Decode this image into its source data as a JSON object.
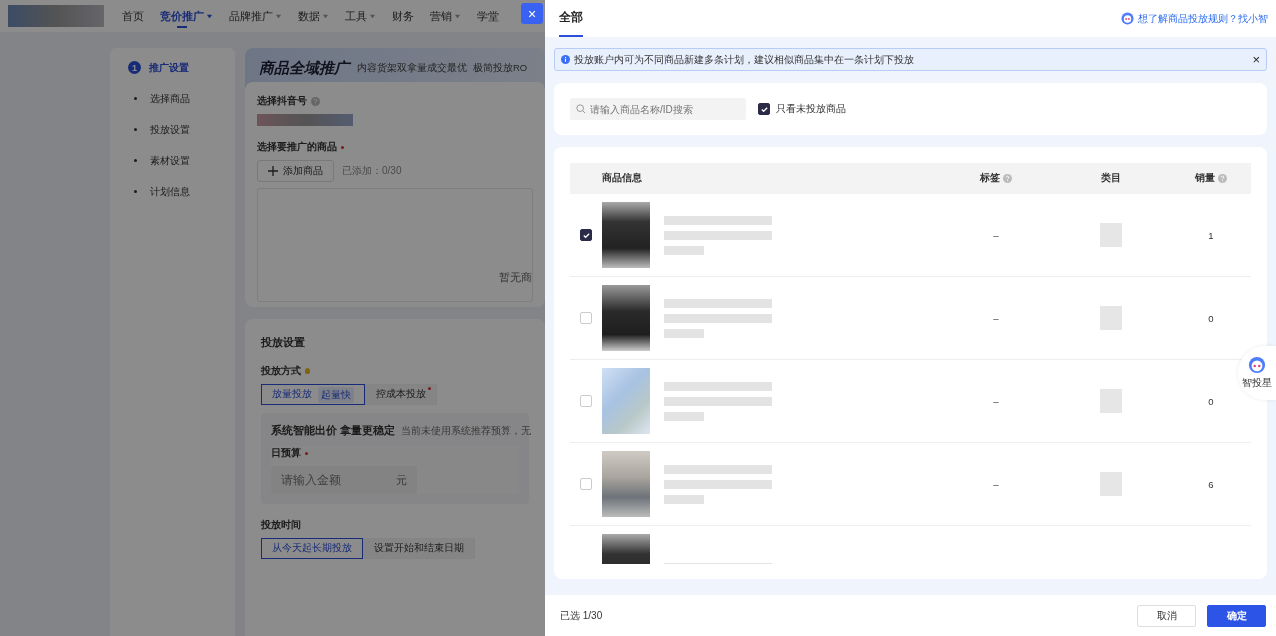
{
  "nav": {
    "items": [
      {
        "label": "首页",
        "selected": false,
        "dropdown": false
      },
      {
        "label": "竞价推广",
        "selected": true,
        "dropdown": true
      },
      {
        "label": "品牌推广",
        "selected": false,
        "dropdown": true
      },
      {
        "label": "数据",
        "selected": false,
        "dropdown": true
      },
      {
        "label": "工具",
        "selected": false,
        "dropdown": true
      },
      {
        "label": "财务",
        "selected": false,
        "dropdown": false
      },
      {
        "label": "营销",
        "selected": false,
        "dropdown": true
      },
      {
        "label": "学堂",
        "selected": false,
        "dropdown": false
      }
    ]
  },
  "close_button": "×",
  "steps": [
    {
      "kind": "numbered",
      "number": "1",
      "label": "推广设置",
      "selected": true
    },
    {
      "kind": "bullet",
      "label": "选择商品",
      "selected": false
    },
    {
      "kind": "bullet",
      "label": "投放设置",
      "selected": false
    },
    {
      "kind": "bullet",
      "label": "素材设置",
      "selected": false
    },
    {
      "kind": "bullet",
      "label": "计划信息",
      "selected": false
    }
  ],
  "banner": {
    "title": "商品全域推广",
    "features": [
      "内容货架双拿量成交最优",
      "极简投放RO"
    ]
  },
  "product_card": {
    "account_label": "选择抖音号",
    "product_label": "选择要推广的商品",
    "required": true,
    "add_button": "添加商品",
    "added_count": "已添加：0/30",
    "empty_text": "暂无商"
  },
  "delivery": {
    "title": "投放设置",
    "method_label": "投放方式",
    "methods": [
      {
        "label": "放量投放",
        "badge": "起量快",
        "selected": true,
        "dot": false
      },
      {
        "label": "控成本投放",
        "selected": false,
        "dot": true
      }
    ],
    "bid_title": "系统智能出价 拿量更稳定",
    "bid_note": "当前未使用系统推荐预算，无",
    "budget": {
      "label": "日预算",
      "required": true,
      "placeholder": "请输入金额",
      "unit": "元"
    },
    "time_label": "投放时间",
    "time_options": [
      {
        "label": "从今天起长期投放",
        "selected": true
      },
      {
        "label": "设置开始和结束日期",
        "selected": false
      }
    ]
  },
  "drawer": {
    "tabs": [
      {
        "label": "全部",
        "selected": true
      }
    ],
    "help_link": "想了解商品投放规则？找小智",
    "alert": {
      "text": "投放账户内可为不同商品新建多条计划，建议相似商品集中在一条计划下投放",
      "close": "×"
    },
    "search": {
      "placeholder": "请输入商品名称/ID搜索"
    },
    "filter": {
      "label": "只看未投放商品",
      "checked": true
    },
    "table": {
      "columns": [
        {
          "label": "商品信息",
          "help": false
        },
        {
          "label": "标签",
          "help": true
        },
        {
          "label": "类目",
          "help": false
        },
        {
          "label": "销量",
          "help": true
        }
      ],
      "rows": [
        {
          "checked": true,
          "tag": "–",
          "sales": "1"
        },
        {
          "checked": false,
          "tag": "–",
          "sales": "0"
        },
        {
          "checked": false,
          "tag": "–",
          "sales": "0"
        },
        {
          "checked": false,
          "tag": "–",
          "sales": "6"
        }
      ]
    },
    "footer": {
      "selected_count": "已选 1/30",
      "buttons": [
        {
          "label": "取消",
          "kind": "secondary"
        },
        {
          "label": "确定",
          "kind": "primary"
        }
      ]
    },
    "assistant": {
      "label": "智投星"
    }
  }
}
